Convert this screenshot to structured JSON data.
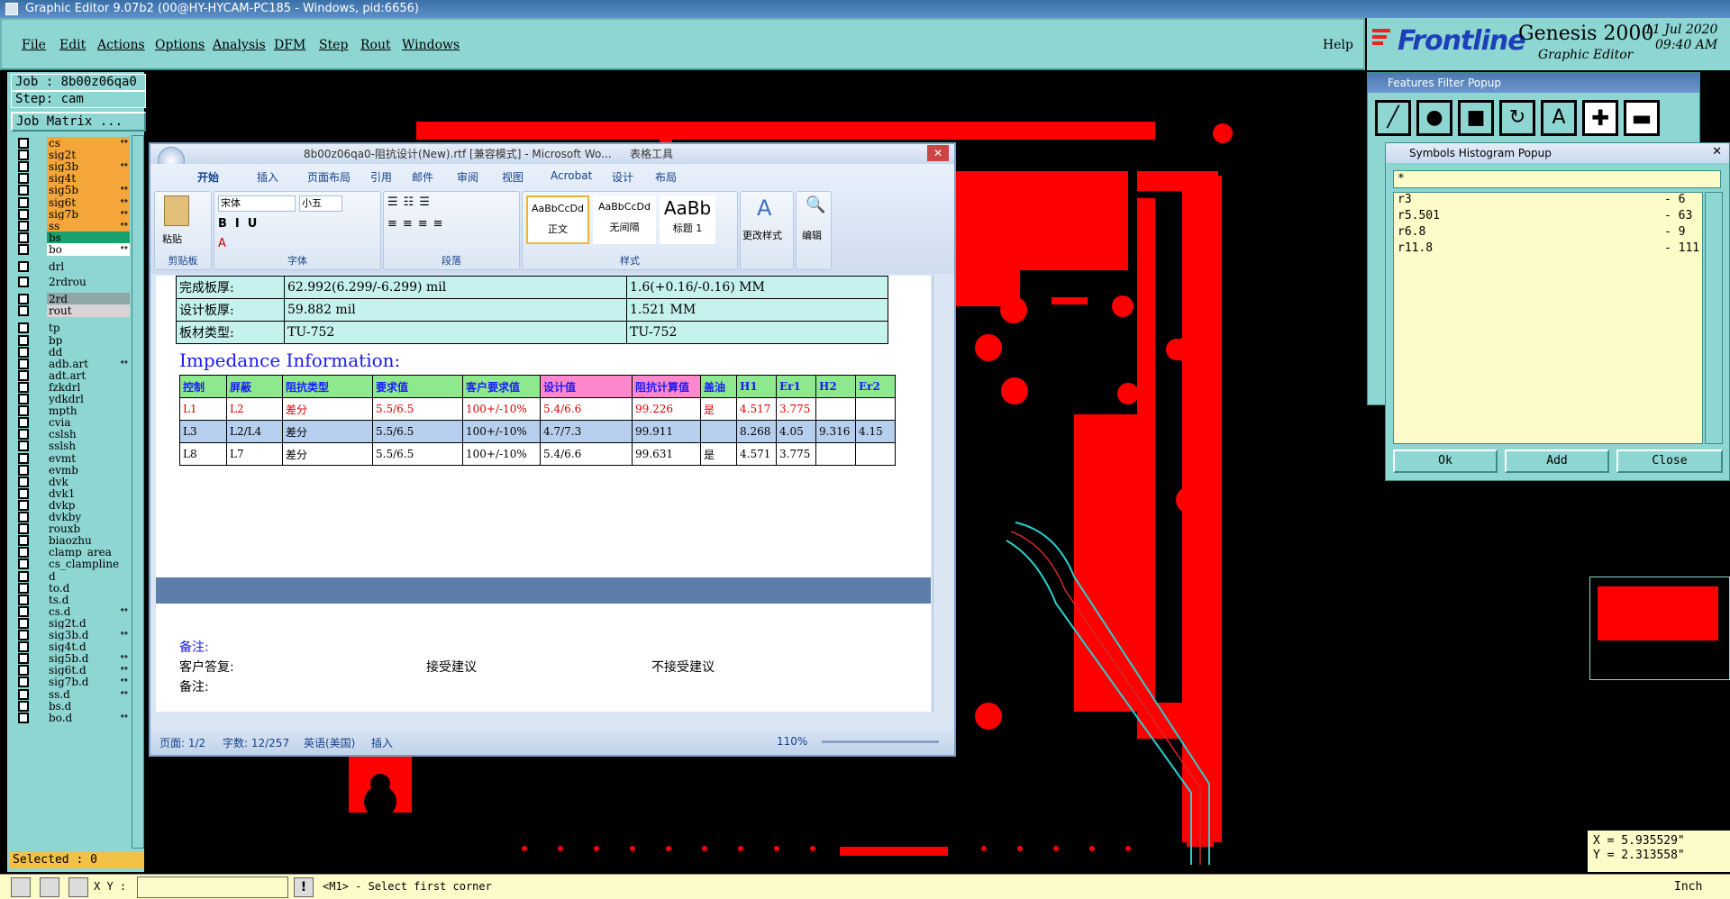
{
  "window_title": "Graphic Editor 9.07b2 (00@HY-HYCAM-PC185 - Windows, pid:6656)",
  "menu": [
    "File",
    "Edit",
    "Actions",
    "Options",
    "Analysis",
    "DFM",
    "Step",
    "Rout",
    "Windows"
  ],
  "menu_help": "Help",
  "brand": {
    "name": "Frontline",
    "product": "Genesis 2000",
    "subtitle": "Graphic Editor",
    "date": "11 Jul 2020",
    "time": "09:40 AM"
  },
  "left": {
    "job": "Job : 8b00z06qa0",
    "step": "Step: cam",
    "matrix_button": "Job Matrix ...",
    "layers": [
      {
        "name": "cs",
        "color": "#f4a63a",
        "arrow": "↔"
      },
      {
        "name": "sig2t",
        "color": "#f4a63a"
      },
      {
        "name": "sig3b",
        "color": "#f4a63a",
        "arrow": "↔"
      },
      {
        "name": "sig4t",
        "color": "#f4a63a"
      },
      {
        "name": "sig5b",
        "color": "#f4a63a",
        "arrow": "↔"
      },
      {
        "name": "sig6t",
        "color": "#f4a63a",
        "arrow": "↔"
      },
      {
        "name": "sig7b",
        "color": "#f4a63a",
        "arrow": "↔"
      },
      {
        "name": "ss",
        "color": "#f4a63a",
        "arrow": "↔"
      },
      {
        "name": "bs",
        "color": "#1aa06e"
      },
      {
        "name": "bo",
        "color": "#ffffff",
        "arrow": "↔"
      },
      {
        "name": "drl",
        "color": "#8dd6d2"
      },
      {
        "name": "2rdrou",
        "color": "#8dd6d2"
      },
      {
        "name": "2rd",
        "color": "#8fa7a6"
      },
      {
        "name": "rout",
        "color": "#d5d5d5"
      },
      {
        "name": "tp",
        "color": "#8dd6d2"
      },
      {
        "name": "bp",
        "color": "#8dd6d2"
      },
      {
        "name": "dd",
        "color": "#8dd6d2"
      },
      {
        "name": "adb.art",
        "color": "#8dd6d2",
        "arrow": "↔"
      },
      {
        "name": "adt.art",
        "color": "#8dd6d2"
      },
      {
        "name": "fzkdrl",
        "color": "#8dd6d2"
      },
      {
        "name": "ydkdrl",
        "color": "#8dd6d2"
      },
      {
        "name": "mpth",
        "color": "#8dd6d2"
      },
      {
        "name": "cvia",
        "color": "#8dd6d2"
      },
      {
        "name": "cslsh",
        "color": "#8dd6d2"
      },
      {
        "name": "sslsh",
        "color": "#8dd6d2"
      },
      {
        "name": "evmt",
        "color": "#8dd6d2"
      },
      {
        "name": "evmb",
        "color": "#8dd6d2"
      },
      {
        "name": "dvk",
        "color": "#8dd6d2"
      },
      {
        "name": "dvk1",
        "color": "#8dd6d2"
      },
      {
        "name": "dvkp",
        "color": "#8dd6d2"
      },
      {
        "name": "dvkby",
        "color": "#8dd6d2"
      },
      {
        "name": "rouxb",
        "color": "#8dd6d2"
      },
      {
        "name": "biaozhu",
        "color": "#8dd6d2"
      },
      {
        "name": "clamp_area",
        "color": "#8dd6d2"
      },
      {
        "name": "cs_clampline",
        "color": "#8dd6d2"
      },
      {
        "name": "d",
        "color": "#8dd6d2"
      },
      {
        "name": "to.d",
        "color": "#8dd6d2"
      },
      {
        "name": "ts.d",
        "color": "#8dd6d2"
      },
      {
        "name": "cs.d",
        "color": "#8dd6d2",
        "arrow": "↔"
      },
      {
        "name": "sig2t.d",
        "color": "#8dd6d2"
      },
      {
        "name": "sig3b.d",
        "color": "#8dd6d2",
        "arrow": "↔"
      },
      {
        "name": "sig4t.d",
        "color": "#8dd6d2"
      },
      {
        "name": "sig5b.d",
        "color": "#8dd6d2",
        "arrow": "↔"
      },
      {
        "name": "sig6t.d",
        "color": "#8dd6d2",
        "arrow": "↔"
      },
      {
        "name": "sig7b.d",
        "color": "#8dd6d2",
        "arrow": "↔"
      },
      {
        "name": "ss.d",
        "color": "#8dd6d2",
        "arrow": "↔"
      },
      {
        "name": "bs.d",
        "color": "#8dd6d2"
      },
      {
        "name": "bo.d",
        "color": "#8dd6d2",
        "arrow": "↔"
      }
    ],
    "selected": "Selected : 0"
  },
  "status": {
    "xy_label": "X Y :",
    "message": "<M1> - Select first corner",
    "units": "Inch"
  },
  "coords": {
    "x": "X = 5.935529\"",
    "y": "Y = 2.313558\""
  },
  "features_filter": {
    "title": "Features Filter Popup"
  },
  "symbols_histogram": {
    "title": "Symbols Histogram Popup",
    "filter": "*",
    "rows": [
      {
        "symbol": "r3",
        "count": "- 6"
      },
      {
        "symbol": "r5.501",
        "count": "- 63"
      },
      {
        "symbol": "r6.8",
        "count": "- 9"
      },
      {
        "symbol": "r11.8",
        "count": "- 111"
      }
    ],
    "buttons": [
      "Ok",
      "Add",
      "Close"
    ]
  },
  "word": {
    "title": "8b00z06qa0-阻抗设计(New).rtf [兼容模式] - Microsoft Wo...",
    "context_tab": "表格工具",
    "tabs": [
      "开始",
      "插入",
      "页面布局",
      "引用",
      "邮件",
      "审阅",
      "视图",
      "Acrobat",
      "设计",
      "布局"
    ],
    "groups": {
      "clipboard": "剪贴板",
      "font": "字体",
      "paragraph": "段落",
      "styles": "样式",
      "editing": "编辑"
    },
    "paste_label": "粘贴",
    "font_name": "宋体",
    "font_size": "小五",
    "style_normal": "正文",
    "style_nospace": "无间隔",
    "style_h1": "标题 1",
    "style_sample1": "AaBbCcDd",
    "style_sample2": "AaBbCcDd",
    "style_sample3": "AaBb",
    "change_styles": "更改样式",
    "board_rows": [
      [
        "完成板厚:",
        "62.992(6.299/-6.299) mil",
        "1.6(+0.16/-0.16) MM"
      ],
      [
        "设计板厚:",
        "59.882 mil",
        "1.521 MM"
      ],
      [
        "板材类型:",
        "TU-752",
        "TU-752"
      ]
    ],
    "impedance_heading": "Impedance Information:",
    "imp_headers": [
      "控制",
      "屏蔽",
      "阻抗类型",
      "要求值",
      "客户要求值",
      "设计值",
      "阻抗计算值",
      "盖油",
      "H1",
      "Er1",
      "H2",
      "Er2"
    ],
    "imp_rows": [
      [
        "L1",
        "L2",
        "差分",
        "5.5/6.5",
        "100+/-10%",
        "5.4/6.6",
        "99.226",
        "是",
        "4.517",
        "3.775",
        "",
        ""
      ],
      [
        "L3",
        "L2/L4",
        "差分",
        "5.5/6.5",
        "100+/-10%",
        "4.7/7.3",
        "99.911",
        "",
        "8.268",
        "4.05",
        "9.316",
        "4.15"
      ],
      [
        "L8",
        "L7",
        "差分",
        "5.5/6.5",
        "100+/-10%",
        "5.4/6.6",
        "99.631",
        "是",
        "4.571",
        "3.775",
        "",
        ""
      ]
    ],
    "notes_label": "备注:",
    "reply_label": "客户答复:",
    "accept": "接受建议",
    "reject": "不接受建议",
    "notes_label2": "备注:",
    "status_page": "页面: 1/2",
    "status_words": "字数: 12/257",
    "status_lang": "英语(美国)",
    "status_mode": "插入",
    "zoom": "110%"
  }
}
